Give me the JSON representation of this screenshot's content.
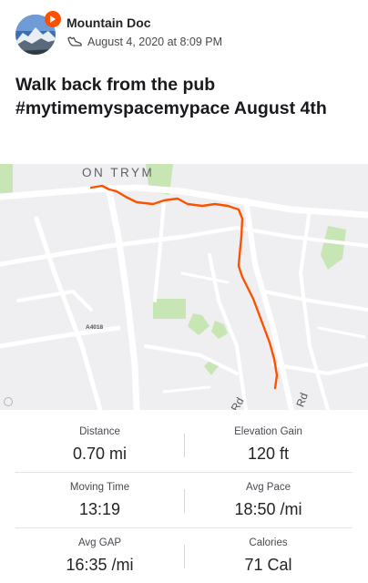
{
  "activity": {
    "athlete_name": "Mountain Doc",
    "timestamp": "August 4, 2020 at 8:09 PM",
    "activity_icon": "walk-shoe-icon",
    "title": "Walk back from the pub #mytimemyspacemypace August 4th"
  },
  "map": {
    "place_label": "ON TRYM",
    "road_label": "A4018",
    "street_suffix_1": "Rd",
    "street_suffix_2": "Rd",
    "route_color": "#fc5200"
  },
  "stats": {
    "distance": {
      "label": "Distance",
      "value": "0.70 mi"
    },
    "elevation_gain": {
      "label": "Elevation Gain",
      "value": "120 ft"
    },
    "moving_time": {
      "label": "Moving Time",
      "value": "13:19"
    },
    "avg_pace": {
      "label": "Avg Pace",
      "value": "18:50 /mi"
    },
    "avg_gap": {
      "label": "Avg GAP",
      "value": "16:35 /mi"
    },
    "calories": {
      "label": "Calories",
      "value": "71 Cal"
    }
  },
  "colors": {
    "brand": "#fc5200",
    "park": "#c8e6b4",
    "text": "#242428"
  }
}
